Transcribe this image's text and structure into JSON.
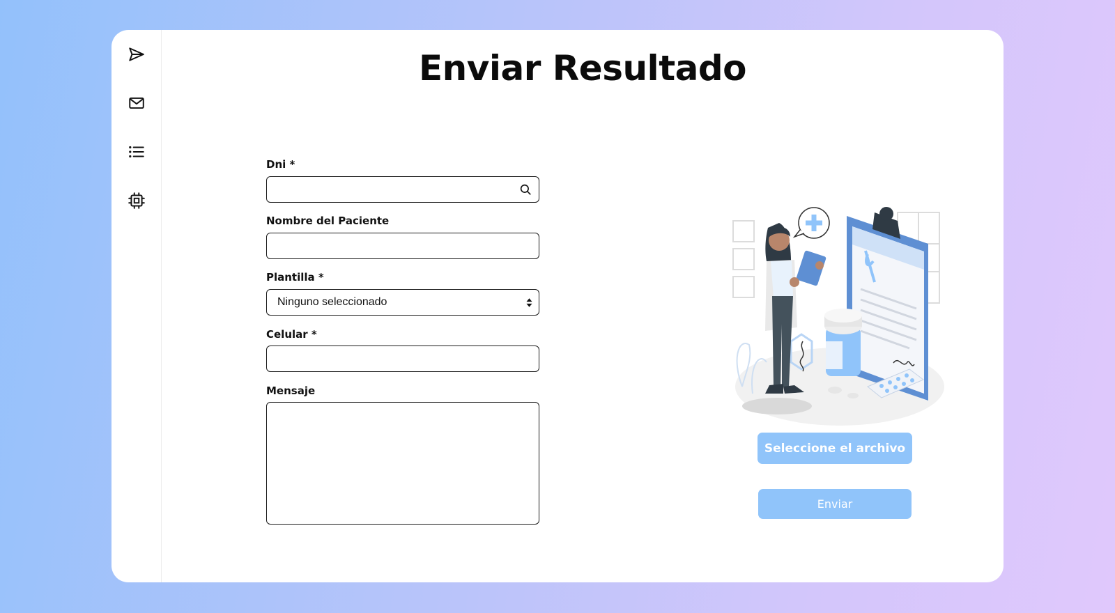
{
  "page": {
    "title": "Enviar Resultado"
  },
  "sidebar": {
    "items": [
      {
        "icon": "send-icon"
      },
      {
        "icon": "mail-icon"
      },
      {
        "icon": "list-icon"
      },
      {
        "icon": "cpu-icon"
      }
    ]
  },
  "form": {
    "dni_label": "Dni *",
    "dni_value": "",
    "patient_label": "Nombre del Paciente",
    "patient_value": "",
    "template_label": "Plantilla *",
    "template_selected": "Ninguno seleccionado",
    "phone_label": "Celular *",
    "phone_value": "",
    "message_label": "Mensaje",
    "message_value": ""
  },
  "actions": {
    "select_file_label": "Seleccione el archivo",
    "send_label": "Enviar"
  },
  "colors": {
    "button": "#90c4fa",
    "button_text": "#ffffff",
    "accent": "#5e8fd3"
  }
}
